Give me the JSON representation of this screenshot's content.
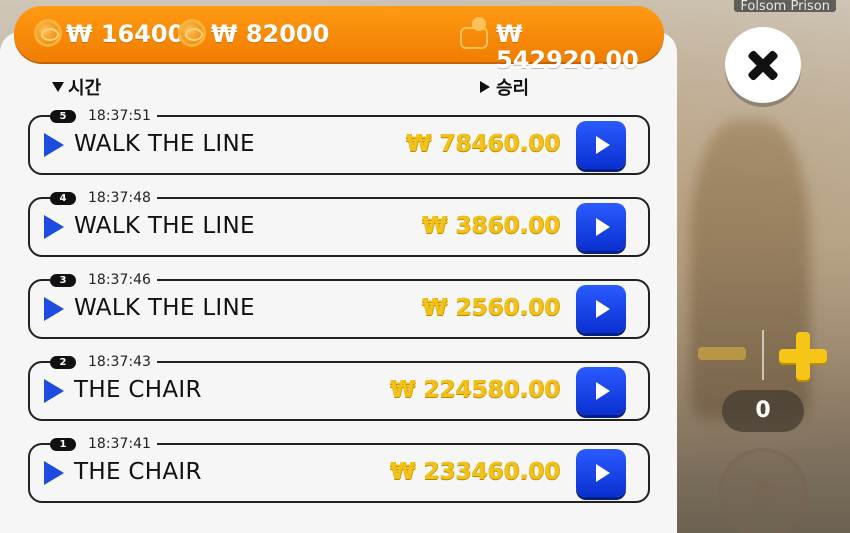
{
  "background_title": "Folsom Prison",
  "balances": {
    "coin1": "₩ 16400",
    "coin2": "₩ 82000",
    "wallet": "₩ 542920.00"
  },
  "headers": {
    "time": "시간",
    "win": "승리"
  },
  "history": [
    {
      "round": "5",
      "time": "18:37:51",
      "song": "WALK THE LINE",
      "win": "₩ 78460.00"
    },
    {
      "round": "4",
      "time": "18:37:48",
      "song": "WALK THE LINE",
      "win": "₩ 3860.00"
    },
    {
      "round": "3",
      "time": "18:37:46",
      "song": "WALK THE LINE",
      "win": "₩ 2560.00"
    },
    {
      "round": "2",
      "time": "18:37:43",
      "song": "THE CHAIR",
      "win": "₩ 224580.00"
    },
    {
      "round": "1",
      "time": "18:37:41",
      "song": "THE CHAIR",
      "win": "₩ 233460.00"
    }
  ],
  "controls": {
    "bet_value": "0"
  },
  "icons": {
    "close": "close-icon",
    "coin": "coin-icon",
    "wallet": "wallet-icon",
    "play": "play-icon",
    "replay": "replay-icon",
    "minus": "minus-icon",
    "plus": "plus-icon",
    "spin": "spin-icon"
  },
  "colors": {
    "topbar": "#f07d00",
    "win_text": "#f2c21a",
    "replay_button": "#1f4ce0",
    "play_marker": "#1f4ce0"
  }
}
